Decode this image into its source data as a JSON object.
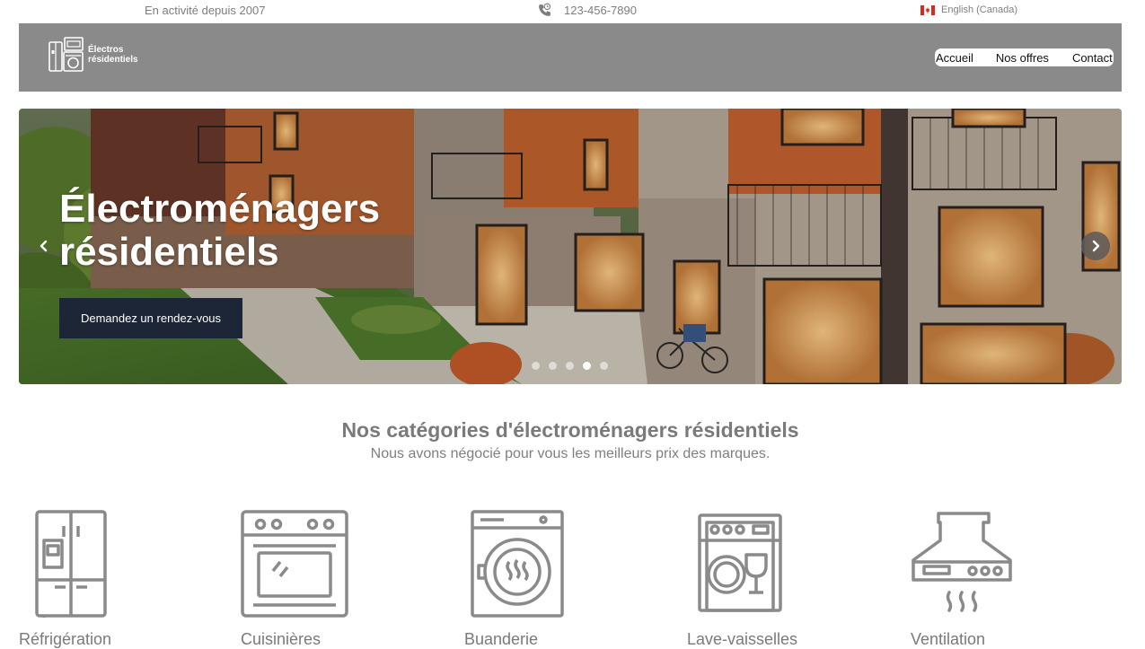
{
  "topbar": {
    "since": "En activité depuis 2007",
    "phone": "123-456-7890",
    "language": "English (Canada)"
  },
  "header": {
    "logo_line1": "Électros",
    "logo_line2": "résidentiels",
    "nav": [
      {
        "label": "Accueil"
      },
      {
        "label": "Nos offres"
      },
      {
        "label": "Contact"
      }
    ]
  },
  "hero": {
    "title": "Électroménagers résidentiels",
    "cta_label": "Demandez un rendez-vous",
    "slide_count": 5,
    "active_slide": 4
  },
  "categories": {
    "title": "Nos catégories d'électroménagers résidentiels",
    "subtitle": "Nous avons négocié pour vous les meilleurs prix des marques.",
    "items": [
      {
        "label": "Réfrigération",
        "icon": "refrigerator-icon"
      },
      {
        "label": "Cuisinières",
        "icon": "stove-icon"
      },
      {
        "label": "Buanderie",
        "icon": "washer-icon"
      },
      {
        "label": "Lave-vaisselles",
        "icon": "dishwasher-icon"
      },
      {
        "label": "Ventilation",
        "icon": "range-hood-icon"
      }
    ]
  },
  "colors": {
    "header_bg": "#8a8a8a",
    "cta_bg": "#1c2636",
    "icon_stroke": "#8a8a8a",
    "text_gray": "#7a7a7a"
  }
}
